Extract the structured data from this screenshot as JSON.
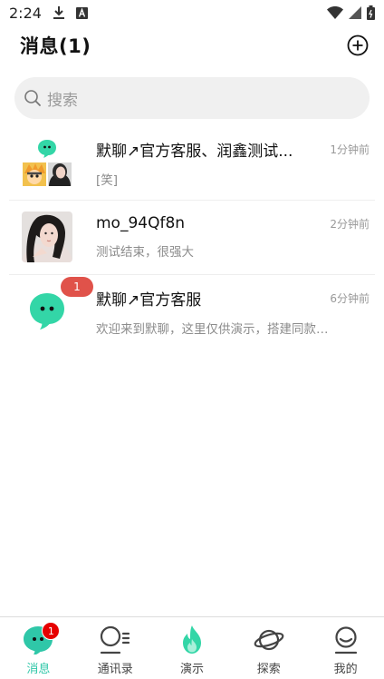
{
  "status_bar": {
    "time": "2:24",
    "icons": [
      "download-icon",
      "font-a-icon",
      "wifi-icon",
      "signal-icon",
      "battery-icon"
    ]
  },
  "header": {
    "title": "消息(1)",
    "add_icon": "plus-circle-icon"
  },
  "search": {
    "placeholder": "搜索",
    "icon": "search-icon"
  },
  "conversations": [
    {
      "name": "默聊↗官方客服、润鑫测试...",
      "preview": "[笑]",
      "time": "1分钟前",
      "avatar": "group-avatar-grid"
    },
    {
      "name": "mo_94Qf8n",
      "preview": "测试结束，很强大",
      "time": "2分钟前",
      "avatar": "user-photo-avatar"
    },
    {
      "name": "默聊↗官方客服",
      "preview": "欢迎来到默聊，这里仅供演示，搭建同款…",
      "time": "6分钟前",
      "avatar": "service-bot-avatar",
      "unread": "1"
    }
  ],
  "tabs": [
    {
      "label": "消息",
      "icon": "chat-bubble-icon",
      "active": true,
      "badge": "1"
    },
    {
      "label": "通讯录",
      "icon": "contacts-icon",
      "active": false
    },
    {
      "label": "演示",
      "icon": "flame-icon",
      "active": false
    },
    {
      "label": "探索",
      "icon": "planet-icon",
      "active": false
    },
    {
      "label": "我的",
      "icon": "profile-icon",
      "active": false
    }
  ],
  "colors": {
    "accent": "#2fc7a8",
    "mint": "#33d6a7",
    "unread_red": "#e0524a",
    "badge_red": "#e60000"
  }
}
